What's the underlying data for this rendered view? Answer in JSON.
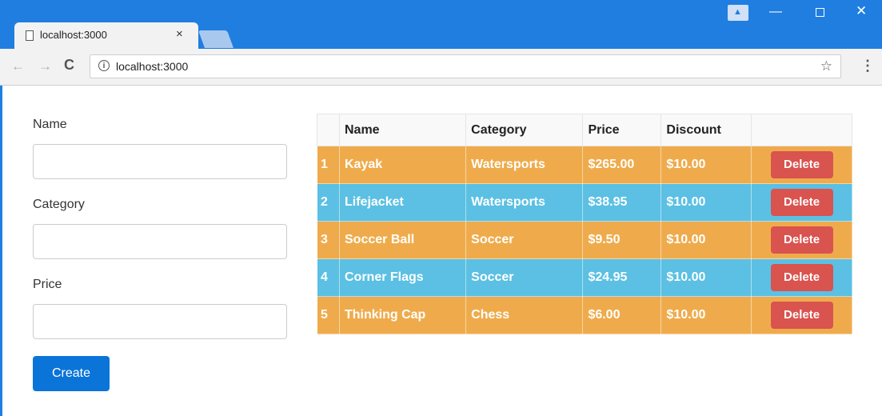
{
  "browser": {
    "tab_title": "localhost:3000",
    "tab_close": "×",
    "url": "localhost:3000",
    "icons": [
      "file-icon",
      "close-icon",
      "back-icon",
      "forward-icon",
      "reload-icon",
      "info-icon",
      "star-icon",
      "menu-icon",
      "profile-icon"
    ],
    "back_glyph": "←",
    "forward_glyph": "→",
    "reload_glyph": "C",
    "info_glyph": "i",
    "star_glyph": "☆",
    "menu_glyph": "⋮",
    "min_glyph": "—",
    "close_glyph": "✕",
    "profile_glyph": "▲"
  },
  "form": {
    "name_label": "Name",
    "category_label": "Category",
    "price_label": "Price",
    "name_value": "",
    "category_value": "",
    "price_value": "",
    "create_label": "Create"
  },
  "table": {
    "headers": [
      "",
      "Name",
      "Category",
      "Price",
      "Discount",
      ""
    ],
    "rows": [
      {
        "index": "1",
        "name": "Kayak",
        "category": "Watersports",
        "price": "$265.00",
        "discount": "$10.00",
        "action": "Delete"
      },
      {
        "index": "2",
        "name": "Lifejacket",
        "category": "Watersports",
        "price": "$38.95",
        "discount": "$10.00",
        "action": "Delete"
      },
      {
        "index": "3",
        "name": "Soccer Ball",
        "category": "Soccer",
        "price": "$9.50",
        "discount": "$10.00",
        "action": "Delete"
      },
      {
        "index": "4",
        "name": "Corner Flags",
        "category": "Soccer",
        "price": "$24.95",
        "discount": "$10.00",
        "action": "Delete"
      },
      {
        "index": "5",
        "name": "Thinking Cap",
        "category": "Chess",
        "price": "$6.00",
        "discount": "$10.00",
        "action": "Delete"
      }
    ]
  },
  "colors": {
    "chrome_blue": "#1f7ee0",
    "row_orange": "#efab4b",
    "row_blue": "#5bc0e3",
    "delete_red": "#d9534f",
    "create_blue": "#0b74d8"
  }
}
